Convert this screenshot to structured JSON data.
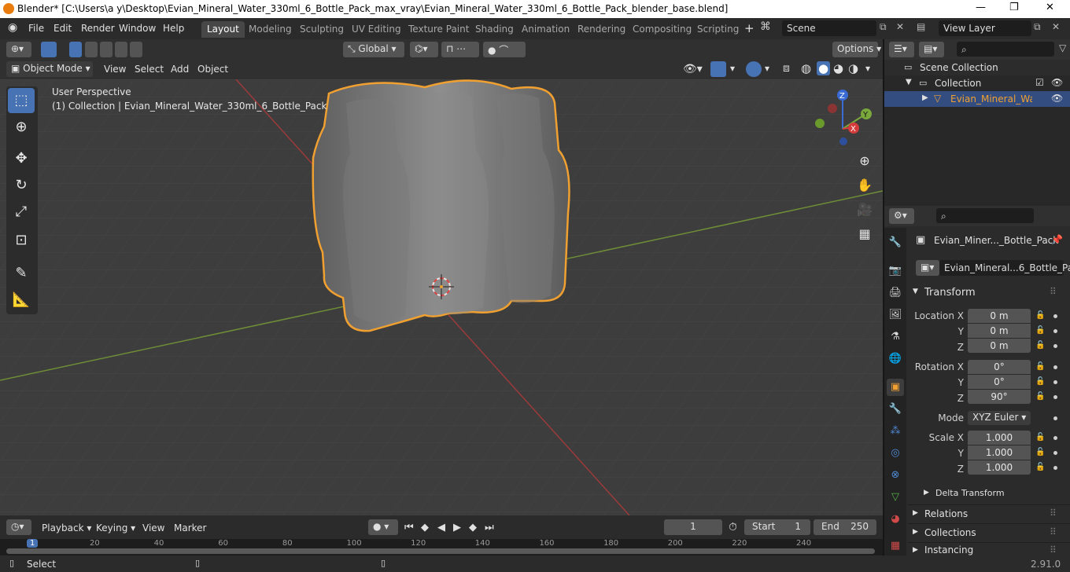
{
  "window": {
    "title": "Blender* [C:\\Users\\a y\\Desktop\\Evian_Mineral_Water_330ml_6_Bottle_Pack_max_vray\\Evian_Mineral_Water_330ml_6_Bottle_Pack_blender_base.blend]",
    "minimize": "—",
    "maximize": "❐",
    "close": "✕"
  },
  "menu": [
    "File",
    "Edit",
    "Render",
    "Window",
    "Help"
  ],
  "workspaces": [
    "Layout",
    "Modeling",
    "Sculpting",
    "UV Editing",
    "Texture Paint",
    "Shading",
    "Animation",
    "Rendering",
    "Compositing",
    "Scripting"
  ],
  "scene": {
    "label": "Scene",
    "view_layer": "View Layer"
  },
  "viewport": {
    "mode": "Object Mode",
    "menus": [
      "View",
      "Select",
      "Add",
      "Object"
    ],
    "transform_orientation": "Global",
    "options_label": "Options",
    "overlay_title": "User Perspective",
    "overlay_sub": "(1) Collection | Evian_Mineral_Water_330ml_6_Bottle_Pack",
    "gizmo": {
      "z": "Z",
      "y": "Y",
      "x": "X"
    }
  },
  "outliner": {
    "search_placeholder": "",
    "items": [
      "Scene Collection",
      "Collection",
      "Evian_Mineral_Water"
    ]
  },
  "properties": {
    "object_name": "Evian_Miner..._Bottle_Pack",
    "data_name": "Evian_Mineral...6_Bottle_Pack",
    "transform_label": "Transform",
    "location_x_label": "Location X",
    "y_label": "Y",
    "z_label": "Z",
    "location": [
      "0 m",
      "0 m",
      "0 m"
    ],
    "rotation_x_label": "Rotation X",
    "rotation": [
      "0°",
      "0°",
      "90°"
    ],
    "mode_label": "Mode",
    "mode_value": "XYZ Euler",
    "scale_x_label": "Scale X",
    "scale": [
      "1.000",
      "1.000",
      "1.000"
    ],
    "delta_transform": "Delta Transform",
    "sections": [
      "Relations",
      "Collections",
      "Instancing"
    ]
  },
  "timeline": {
    "menus": [
      "Playback",
      "Keying",
      "View",
      "Marker"
    ],
    "current_frame": "1",
    "start_label": "Start",
    "start_value": "1",
    "end_label": "End",
    "end_value": "250",
    "ruler": [
      "1",
      "20",
      "40",
      "60",
      "80",
      "100",
      "120",
      "140",
      "160",
      "180",
      "200",
      "220",
      "240"
    ]
  },
  "status": {
    "select": "Select",
    "version": "2.91.0"
  },
  "colors": {
    "accent": "#4772b3",
    "selection_outline": "#f0a030",
    "x_axis": "#d43c3c",
    "y_axis": "#7aa83c"
  }
}
